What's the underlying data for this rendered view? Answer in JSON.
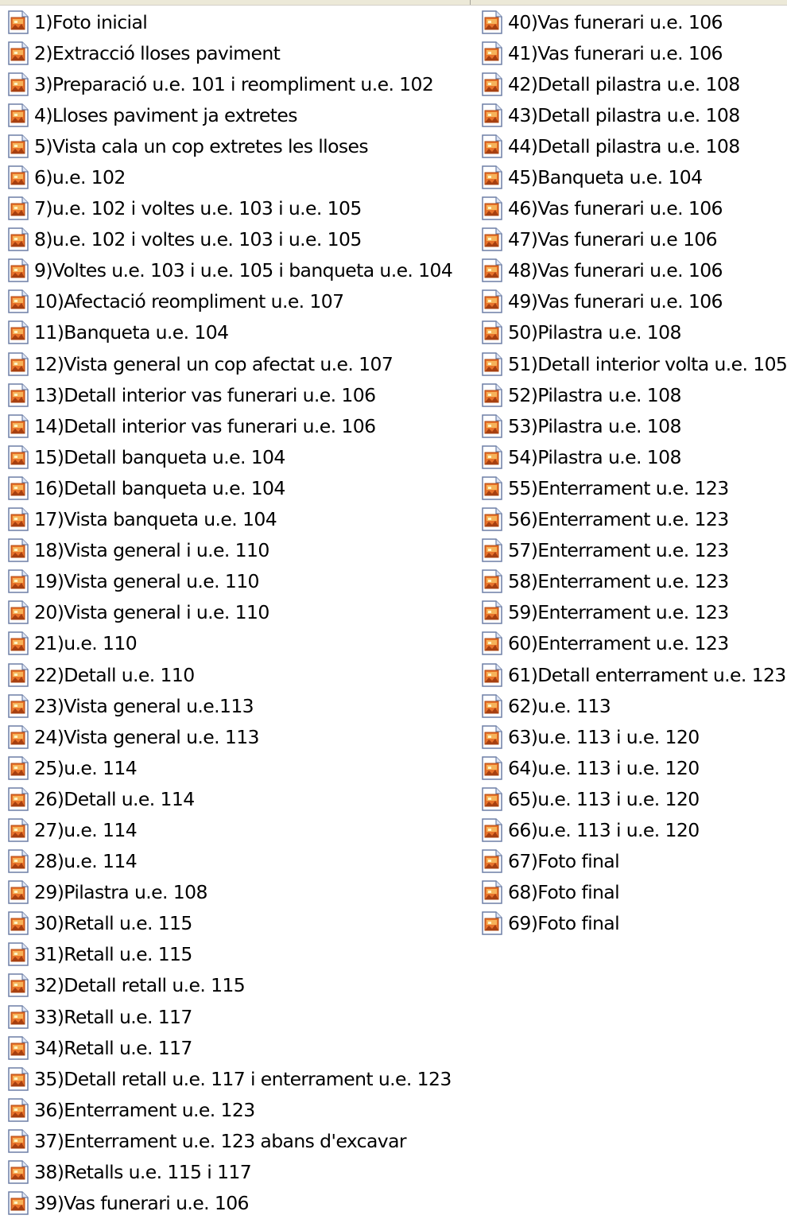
{
  "files": {
    "left_column": [
      "1)Foto inicial",
      "2)Extracció lloses paviment",
      "3)Preparació u.e. 101 i reompliment u.e. 102",
      "4)Lloses paviment ja extretes",
      "5)Vista cala un cop extretes les lloses",
      "6)u.e. 102",
      "7)u.e. 102 i voltes u.e. 103 i u.e. 105",
      "8)u.e. 102 i voltes u.e. 103 i u.e. 105",
      "9)Voltes u.e. 103 i u.e. 105 i banqueta u.e. 104",
      "10)Afectació reompliment u.e. 107",
      "11)Banqueta u.e. 104",
      "12)Vista general un cop afectat u.e. 107",
      "13)Detall interior vas funerari u.e. 106",
      "14)Detall interior vas funerari u.e. 106",
      "15)Detall banqueta u.e. 104",
      "16)Detall banqueta u.e. 104",
      "17)Vista banqueta u.e. 104",
      "18)Vista general i u.e. 110",
      "19)Vista general u.e. 110",
      "20)Vista general i u.e. 110",
      "21)u.e. 110",
      "22)Detall u.e. 110",
      "23)Vista general u.e.113",
      "24)Vista general u.e. 113",
      "25)u.e. 114",
      "26)Detall u.e. 114",
      "27)u.e. 114",
      "28)u.e. 114",
      "29)Pilastra u.e. 108",
      "30)Retall u.e. 115",
      "31)Retall u.e. 115",
      "32)Detall retall u.e. 115",
      "33)Retall u.e. 117",
      "34)Retall u.e. 117",
      "35)Detall retall u.e. 117 i enterrament u.e. 123",
      "36)Enterrament u.e. 123",
      "37)Enterrament u.e. 123 abans d'excavar",
      "38)Retalls u.e. 115 i 117",
      "39)Vas funerari u.e. 106"
    ],
    "right_column": [
      "40)Vas funerari u.e. 106",
      "41)Vas funerari u.e. 106",
      "42)Detall pilastra u.e. 108",
      "43)Detall pilastra u.e. 108",
      "44)Detall pilastra u.e. 108",
      "45)Banqueta u.e. 104",
      "46)Vas funerari u.e. 106",
      "47)Vas funerari u.e 106",
      "48)Vas funerari u.e. 106",
      "49)Vas funerari u.e. 106",
      "50)Pilastra u.e. 108",
      "51)Detall interior volta u.e. 105",
      "52)Pilastra u.e. 108",
      "53)Pilastra u.e. 108",
      "54)Pilastra u.e. 108",
      "55)Enterrament u.e. 123",
      "56)Enterrament u.e. 123",
      "57)Enterrament u.e. 123",
      "58)Enterrament u.e. 123",
      "59)Enterrament u.e. 123",
      "60)Enterrament u.e. 123",
      "61)Detall enterrament u.e. 123",
      "62)u.e. 113",
      "63)u.e. 113 i u.e. 120",
      "64)u.e. 113 i u.e. 120",
      "65)u.e. 113 i u.e. 120",
      "66)u.e. 113 i u.e. 120",
      "67)Foto final",
      "68)Foto final",
      "69)Foto final"
    ],
    "icon": "image-file-icon"
  },
  "colors": {
    "background": "#ffffff",
    "text": "#000000",
    "header_bar": "#ece9d8"
  }
}
